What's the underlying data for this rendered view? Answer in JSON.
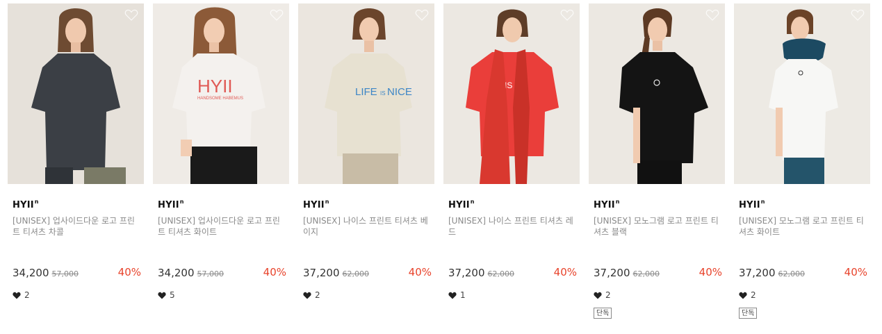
{
  "products": [
    {
      "brand": "HYII",
      "brand_sup": "n",
      "title": "[UNISEX] 업사이드다운 로고 프린트 티셔츠 차콜",
      "price": "34,200",
      "original_price": "57,000",
      "discount": "40%",
      "likes": "2",
      "tag": "",
      "shirt_color": "#3b3f45",
      "print_text": ""
    },
    {
      "brand": "HYII",
      "brand_sup": "n",
      "title": "[UNISEX] 업사이드다운 로고 프린트 티셔츠 화이트",
      "price": "34,200",
      "original_price": "57,000",
      "discount": "40%",
      "likes": "5",
      "tag": "",
      "shirt_color": "#f4f1ee",
      "print_text": "HYII"
    },
    {
      "brand": "HYII",
      "brand_sup": "n",
      "title": "[UNISEX] 나이스 프린트 티셔츠 베이지",
      "price": "37,200",
      "original_price": "62,000",
      "discount": "40%",
      "likes": "2",
      "tag": "",
      "shirt_color": "#e7e1d1",
      "print_text": "LIFE IS NICE"
    },
    {
      "brand": "HYII",
      "brand_sup": "n",
      "title": "[UNISEX] 나이스 프린트 티셔츠 레드",
      "price": "37,200",
      "original_price": "62,000",
      "discount": "40%",
      "likes": "1",
      "tag": "",
      "shirt_color": "#ea3e3a",
      "print_text": "IS NI"
    },
    {
      "brand": "HYII",
      "brand_sup": "n",
      "title": "[UNISEX] 모노그램 로고 프린트 티셔츠 블랙",
      "price": "37,200",
      "original_price": "62,000",
      "discount": "40%",
      "likes": "2",
      "tag": "단독",
      "shirt_color": "#141414",
      "print_text": ""
    },
    {
      "brand": "HYII",
      "brand_sup": "n",
      "title": "[UNISEX] 모노그램 로고 프린트 티셔츠 화이트",
      "price": "37,200",
      "original_price": "62,000",
      "discount": "40%",
      "likes": "2",
      "tag": "단독",
      "shirt_color": "#f7f7f5",
      "print_text": ""
    }
  ],
  "colors": {
    "discount": "#e8432b",
    "muted_text": "#8a8a8a",
    "photo_background": "#ece8e2"
  },
  "icons": {
    "wishlist": "heart-outline-icon",
    "likes": "heart-filled-icon"
  }
}
